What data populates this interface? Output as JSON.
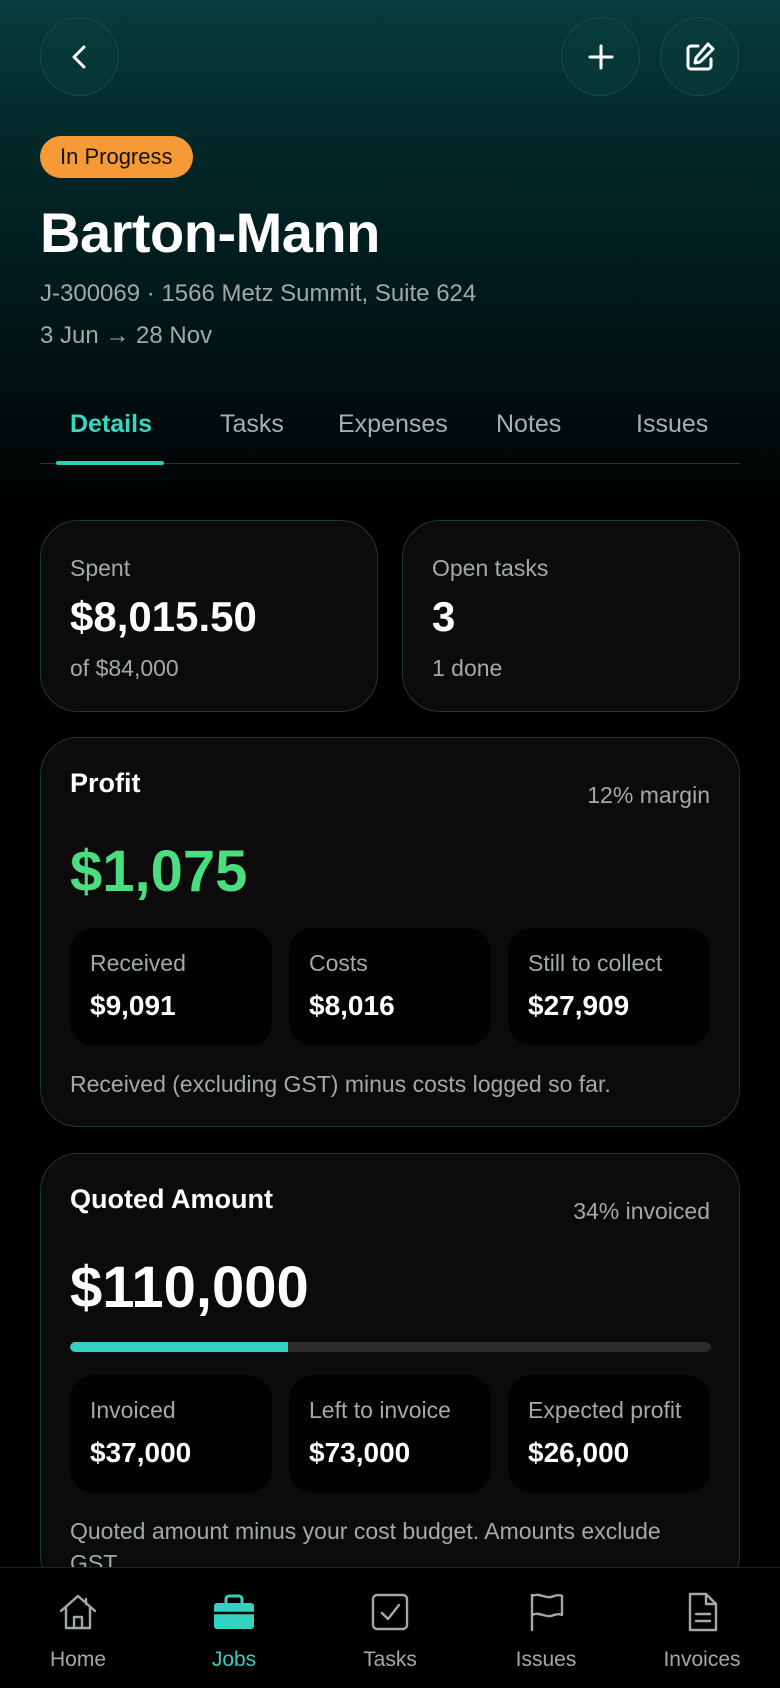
{
  "header": {
    "status": "In Progress",
    "title": "Barton-Mann",
    "address_line": "J-300069 · 1566 Metz Summit, Suite 624",
    "dates": "3 Jun → 28 Nov"
  },
  "tabs": [
    {
      "label": "Details",
      "active": true
    },
    {
      "label": "Tasks"
    },
    {
      "label": "Expenses"
    },
    {
      "label": "Notes"
    },
    {
      "label": "Issues"
    }
  ],
  "stats": {
    "spent": {
      "label": "Spent",
      "value": "$8,015.50",
      "sub": "of $84,000"
    },
    "open_tasks": {
      "label": "Open tasks",
      "value": "3",
      "sub": "1 done"
    }
  },
  "profit": {
    "title": "Profit",
    "margin": "12% margin",
    "amount": "$1,075",
    "amount_color": "#4ade80",
    "items": [
      {
        "label": "Received",
        "value": "$9,091"
      },
      {
        "label": "Costs",
        "value": "$8,016"
      },
      {
        "label": "Still to collect",
        "value": "$27,909"
      }
    ],
    "note": "Received (excluding GST) minus costs logged so far."
  },
  "quoted": {
    "title": "Quoted Amount",
    "invoiced_pct_text": "34% invoiced",
    "invoiced_fraction": 0.34,
    "amount": "$110,000",
    "items": [
      {
        "label": "Invoiced",
        "value": "$37,000"
      },
      {
        "label": "Left to invoice",
        "value": "$73,000"
      },
      {
        "label": "Expected profit",
        "value": "$26,000"
      }
    ],
    "note": "Quoted amount minus your cost budget. Amounts exclude GST."
  },
  "nav": [
    {
      "label": "Home",
      "icon": "home-icon"
    },
    {
      "label": "Jobs",
      "icon": "briefcase-icon",
      "active": true
    },
    {
      "label": "Tasks",
      "icon": "checkbox-icon"
    },
    {
      "label": "Issues",
      "icon": "flag-icon"
    },
    {
      "label": "Invoices",
      "icon": "document-icon"
    }
  ],
  "colors": {
    "accent": "#33d1bf",
    "status_badge": "#f59a36"
  }
}
